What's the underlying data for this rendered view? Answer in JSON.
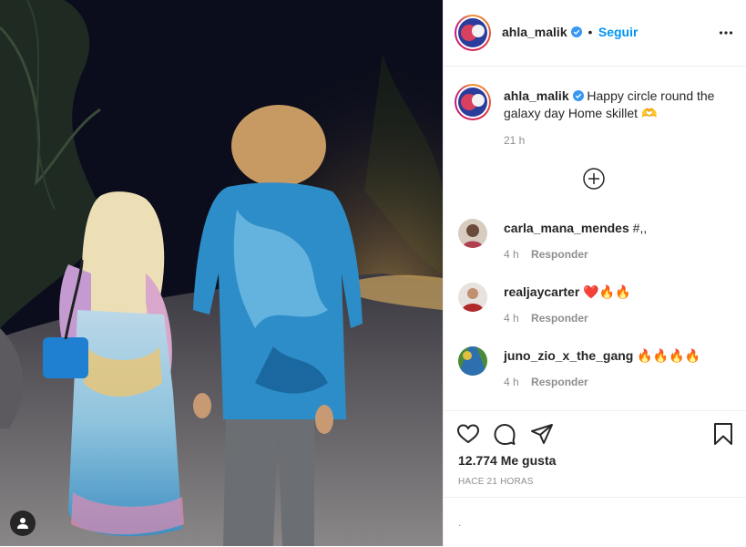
{
  "colors": {
    "accent": "#0095f6",
    "verified": "#3897f0",
    "text": "#262626",
    "muted": "#8e8e8e"
  },
  "header": {
    "username": "ahla_malik",
    "separator": "•",
    "follow_label": "Seguir",
    "more_icon": "ellipsis-icon"
  },
  "caption": {
    "username": "ahla_malik",
    "text": "Happy circle round the galaxy day Home skillet 🫶",
    "time": "21 h"
  },
  "load_more_icon": "plus-circle-icon",
  "comments": [
    {
      "username": "carla_mana_mendes",
      "text": "#,,",
      "time": "4 h",
      "reply_label": "Responder"
    },
    {
      "username": "realjaycarter",
      "text": "❤️🔥🔥",
      "time": "4 h",
      "reply_label": "Responder"
    },
    {
      "username": "juno_zio_x_the_gang",
      "text": "🔥🔥🔥🔥",
      "time": "4 h",
      "reply_label": "Responder"
    }
  ],
  "actions": {
    "like_icon": "heart-icon",
    "comment_icon": "comment-icon",
    "share_icon": "paper-plane-icon",
    "save_icon": "bookmark-icon",
    "likes": "12.774 Me gusta",
    "posted": "HACE 21 HORAS"
  },
  "add_comment": {
    "text": "."
  }
}
